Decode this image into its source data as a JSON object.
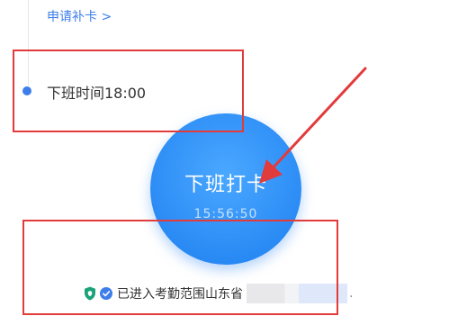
{
  "timeline": {
    "supplement_link": "申请补卡 >",
    "off_duty_time": "下班时间18:00"
  },
  "clock_button": {
    "label": "下班打卡",
    "time": "15:56:50"
  },
  "location": {
    "status_text": "已进入考勤范围山东省",
    "trailing": "."
  },
  "colors": {
    "accent": "#3d7eea",
    "button_blue": "#2f8ff6",
    "annotation_red": "#e23b3b",
    "shield_green": "#1aa37a"
  },
  "icons": {
    "shield": "shield-icon",
    "check": "check-circle-icon"
  }
}
